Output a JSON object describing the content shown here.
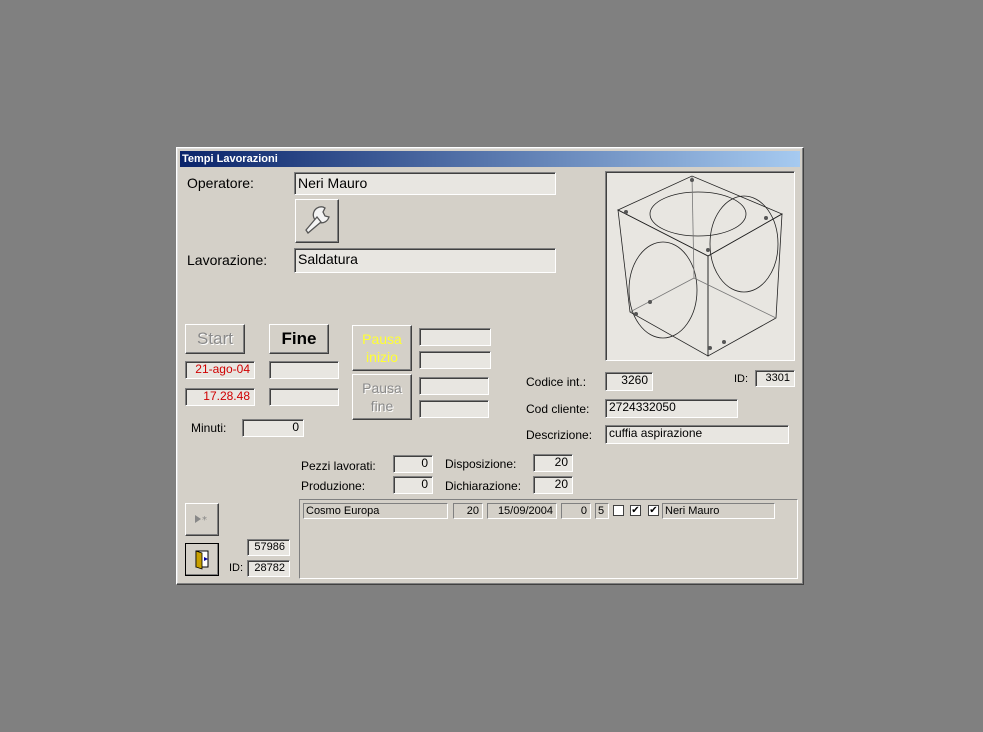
{
  "window": {
    "title": "Tempi Lavorazioni"
  },
  "operatore": {
    "label": "Operatore:",
    "value": "Neri Mauro"
  },
  "lavorazione": {
    "label": "Lavorazione:",
    "value": "Saldatura"
  },
  "buttons": {
    "start": "Start",
    "fine": "Fine",
    "pausa_inizio": "Pausa inizio",
    "pausa_fine": "Pausa fine"
  },
  "start_info": {
    "date": "21-ago-04",
    "time": "17.28.48"
  },
  "minuti": {
    "label": "Minuti:",
    "value": "0"
  },
  "codice_int": {
    "label": "Codice  int.:",
    "value": "3260"
  },
  "id_top": {
    "label": "ID:",
    "value": "3301"
  },
  "cod_cliente": {
    "label": "Cod cliente:",
    "value": "2724332050"
  },
  "descrizione": {
    "label": "Descrizione:",
    "value": "cuffia aspirazione"
  },
  "pezzi_lavorati": {
    "label": "Pezzi lavorati:",
    "value": "0"
  },
  "produzione": {
    "label": "Produzione:",
    "value": "0"
  },
  "disposizione": {
    "label": "Disposizione:",
    "value": "20"
  },
  "dichiarazione": {
    "label": "Dichiarazione:",
    "value": "20"
  },
  "record_row": {
    "cliente": "Cosmo Europa",
    "qty": "20",
    "date": "15/09/2004",
    "n1": "0",
    "n2": "5",
    "check1": false,
    "check2": true,
    "check3": true,
    "operatore": "Neri Mauro"
  },
  "bottom": {
    "record": "57986",
    "id_label": "ID:",
    "id_value": "28782"
  },
  "colors": {
    "accent_red": "#d00000",
    "pausa_yellow": "#ffff33"
  },
  "icons": [
    "wrench-icon",
    "cube-drawing",
    "new-record-icon",
    "exit-door-icon"
  ]
}
